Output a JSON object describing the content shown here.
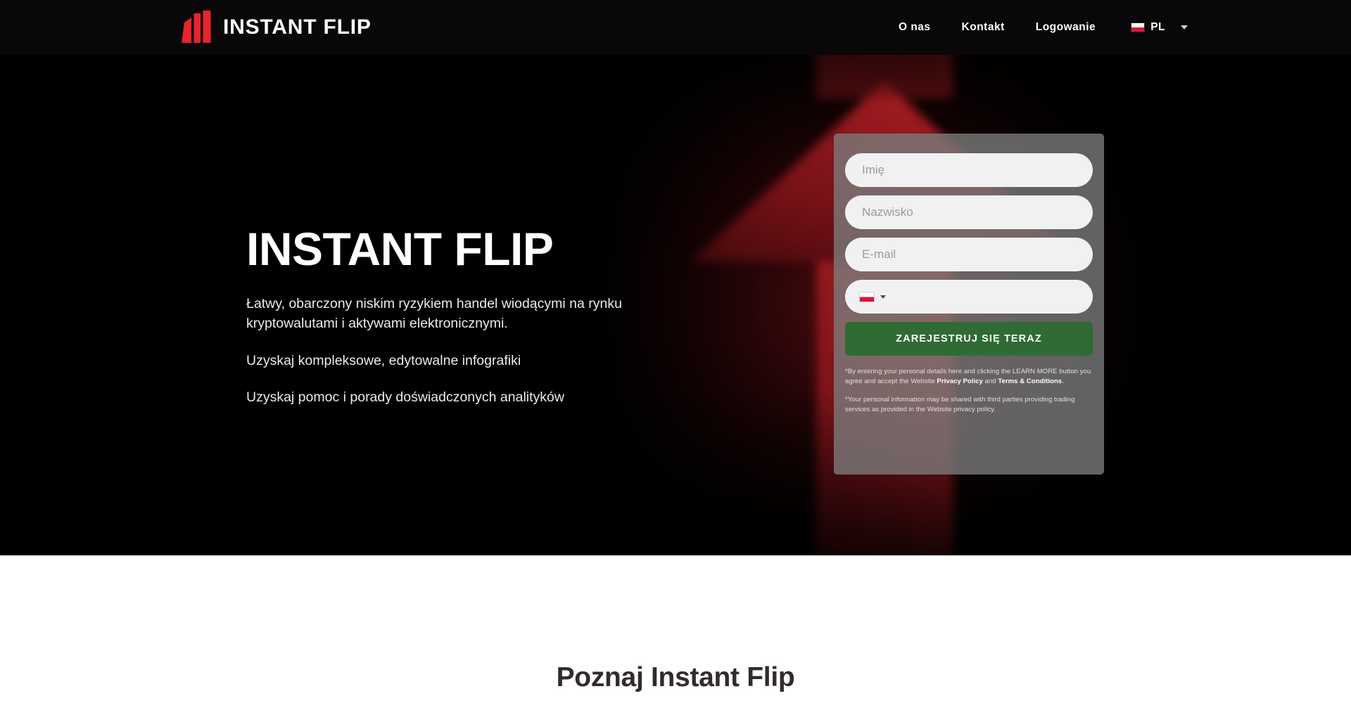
{
  "header": {
    "logo_text": "INSTANT FLIP",
    "logo_icon": "instant-flip-bars-logo",
    "nav": [
      {
        "label": "O nas"
      },
      {
        "label": "Kontakt"
      },
      {
        "label": "Logowanie"
      }
    ],
    "language": {
      "code": "PL",
      "flag_icon": "poland-flag-icon",
      "caret_icon": "chevron-down-icon"
    }
  },
  "hero": {
    "title": "INSTANT FLIP",
    "lead": "Łatwy, obarczony niskim ryzykiem handel wiodącymi na rynku kryptowalutami i aktywami elektronicznymi.",
    "bullet_1": "Uzyskaj kompleksowe, edytowalne infografiki",
    "bullet_2": "Uzyskaj pomoc i porady doświadczonych analityków",
    "background_icon": "red-up-arrow-graphic",
    "accent_color": "#a81a20",
    "background_color": "#000000"
  },
  "signup": {
    "first_name_placeholder": "Imię",
    "last_name_placeholder": "Nazwisko",
    "email_placeholder": "E-mail",
    "first_name_value": "",
    "last_name_value": "",
    "email_value": "",
    "phone_value": "",
    "phone_flag_icon": "poland-flag-icon",
    "phone_caret_icon": "caret-down-icon",
    "submit_label": "ZAREJESTRUJ SIĘ TERAZ",
    "submit_color": "#2f6b33",
    "disclaimer_1_pre": "*By entering your personal details here and clicking the LEARN MORE button you agree and accept the Website ",
    "disclaimer_1_link_1": "Privacy Policy",
    "disclaimer_1_mid": " and ",
    "disclaimer_1_link_2": "Terms & Conditions",
    "disclaimer_1_post": ".",
    "disclaimer_2": "*Your personal information may be shared with third parties providing trading services as provided in the Website privacy policy."
  },
  "intro": {
    "heading": "Poznaj Instant Flip"
  }
}
